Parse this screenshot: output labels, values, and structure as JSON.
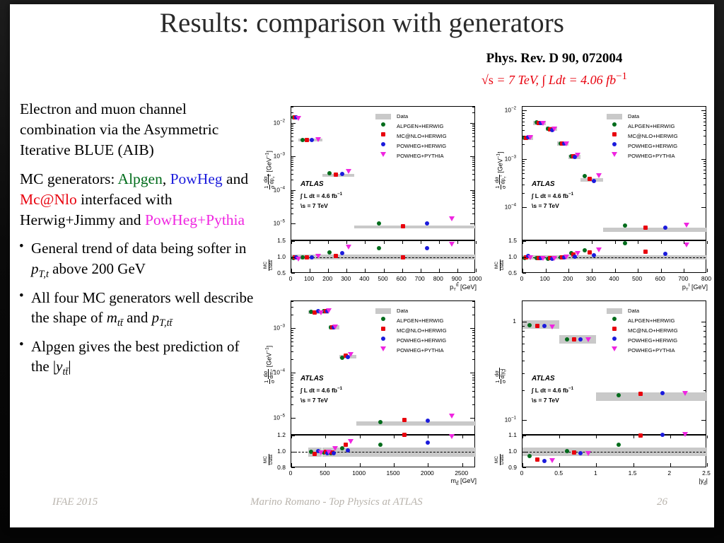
{
  "slide": {
    "title": "Results: comparison with generators",
    "reference": "Phys. Rev. D 90, 072004",
    "lumi_sqrt": "√s",
    "lumi_rest": " = 7 TeV, ∫ Ldt = 4.06 fb",
    "lumi_exp": "−1",
    "footer": {
      "left": "IFAE 2015",
      "center": "Marino Romano - Top Physics at ATLAS",
      "page": "26"
    }
  },
  "text": {
    "p1": "Electron and muon channel combination via the Asymmetric Iterative BLUE (AIB)",
    "p2_pre": "MC generators: ",
    "gen_alpgen": "Alpgen",
    "p2_comma": ", ",
    "gen_powheg": "PowHeg",
    "p2_and": " and ",
    "gen_mcnlo": "Mc@Nlo",
    "p2_mid": " interfaced with Herwig+Jimmy and ",
    "gen_powpythia": "PowHeg+Pythia",
    "bullet1_pre": "General trend of data being softer in ",
    "bullet1_sym": "p",
    "bullet1_sub": "T,t",
    "bullet1_post": " above 200 GeV",
    "bullet2_pre": "All four MC generators well describe the shape of ",
    "bullet2_sym1": "m",
    "bullet2_sub1": "tt̄",
    "bullet2_and": " and ",
    "bullet2_sym2": "p",
    "bullet2_sub2": "T,tt̄",
    "bullet3_pre": "Alpgen gives the best prediction of the ",
    "bullet3_sym": "y",
    "bullet3_sub": "tt̄"
  },
  "legend": {
    "data": "Data",
    "entries": [
      {
        "label": "ALPGEN+HERWIG",
        "color": "#006c1b",
        "marker": "circle"
      },
      {
        "label": "MC@NLO+HERWIG",
        "color": "#e8000d",
        "marker": "square"
      },
      {
        "label": "POWHEG+HERWIG",
        "color": "#1b1bdc",
        "marker": "circle"
      },
      {
        "label": "POWHEG+PYTHIA",
        "color": "#ef25e0",
        "marker": "triangle-down"
      }
    ]
  },
  "atlas_block": {
    "line1": "ATLAS",
    "line2": "∫ L dt = 4.6 fb",
    "line2_exp": "-1",
    "line3": "\\s = 7 TeV"
  },
  "colors": {
    "alpgen": "#006c1b",
    "mcnlo": "#e8000d",
    "powheg_herwig": "#1b1bdc",
    "powheg_pythia": "#ef25e0",
    "data_band": "#c9c9c9",
    "accent_red": "#e8000d"
  },
  "chart_data": [
    {
      "id": "pt_ttbar",
      "position": "top-left",
      "type": "scatter",
      "title": "",
      "xlabel": "p_T^{t#bar{t}} [GeV]",
      "ylabel": "1/σ dσ/dp_T^{t#bar{t}} [GeV^{-1}]",
      "xlim": [
        0,
        1000
      ],
      "xticks": [
        0,
        100,
        200,
        300,
        400,
        500,
        600,
        700,
        800,
        900,
        1000
      ],
      "yscale": "log",
      "ylim": [
        3e-06,
        0.03
      ],
      "ytick_labels": [
        "10^{-2}",
        "10^{-3}",
        "10^{-4}",
        "10^{-5}"
      ],
      "bins": [
        [
          0,
          40
        ],
        [
          40,
          170
        ],
        [
          170,
          340
        ],
        [
          340,
          1000
        ]
      ],
      "data_values": [
        0.0145,
        0.00305,
        0.00027,
        8e-06
      ],
      "series": [
        {
          "name": "ALPGEN+HERWIG",
          "x": [
            12,
            62,
            205,
            475
          ],
          "y": [
            0.0145,
            0.00305,
            0.00031,
            1e-05
          ]
        },
        {
          "name": "MC@NLO+HERWIG",
          "x": [
            20,
            85,
            240,
            605
          ],
          "y": [
            0.0145,
            0.00305,
            0.00028,
            8.2e-06
          ]
        },
        {
          "name": "POWHEG+HERWIG",
          "x": [
            28,
            110,
            275,
            737
          ],
          "y": [
            0.0145,
            0.00305,
            0.0003,
            1e-05
          ]
        },
        {
          "name": "POWHEG+PYTHIA",
          "x": [
            38,
            145,
            310,
            868
          ],
          "y": [
            0.014,
            0.0032,
            0.00036,
            1.4e-05
          ]
        }
      ],
      "ratio": {
        "ylabel": "MC/Data",
        "ylim": [
          0.5,
          1.5
        ],
        "yticks": [
          0.5,
          1.0,
          1.5
        ],
        "refline": 1.0,
        "band": [
          0.93,
          1.08
        ],
        "series": [
          {
            "name": "ALPGEN+HERWIG",
            "x": [
              12,
              62,
              205,
              475
            ],
            "y": [
              0.98,
              1.0,
              1.15,
              1.28
            ]
          },
          {
            "name": "MC@NLO+HERWIG",
            "x": [
              20,
              85,
              240,
              605
            ],
            "y": [
              0.99,
              1.01,
              1.05,
              1.0
            ]
          },
          {
            "name": "POWHEG+HERWIG",
            "x": [
              28,
              110,
              275,
              737
            ],
            "y": [
              0.99,
              1.0,
              1.13,
              1.28
            ]
          },
          {
            "name": "POWHEG+PYTHIA",
            "x": [
              38,
              145,
              310,
              868
            ],
            "y": [
              0.96,
              1.04,
              1.32,
              1.42
            ]
          }
        ]
      }
    },
    {
      "id": "pt_top",
      "position": "top-right",
      "type": "scatter",
      "xlabel": "p_T^{t} [GeV]",
      "ylabel": "1/σ dσ/dp_T^{t} [GeV^{-1}]",
      "xlim": [
        0,
        800
      ],
      "xticks": [
        0,
        100,
        200,
        300,
        400,
        500,
        600,
        700,
        800
      ],
      "yscale": "log",
      "ylim": [
        2e-05,
        0.012
      ],
      "ytick_labels": [
        "10^{-3}",
        "10^{-4}"
      ],
      "bins": [
        [
          0,
          45
        ],
        [
          45,
          100
        ],
        [
          100,
          150
        ],
        [
          150,
          200
        ],
        [
          200,
          250
        ],
        [
          250,
          350
        ],
        [
          350,
          800
        ]
      ],
      "data_values": [
        0.0027,
        0.0055,
        0.0042,
        0.0021,
        0.0011,
        0.00037,
        3.5e-05
      ],
      "series": [
        {
          "name": "ALPGEN+HERWIG",
          "x": [
            8,
            60,
            110,
            165,
            210,
            270,
            443
          ],
          "y": [
            0.0027,
            0.0057,
            0.0042,
            0.0021,
            0.00115,
            0.00044,
            4.2e-05
          ]
        },
        {
          "name": "MC@NLO+HERWIG",
          "x": [
            16,
            70,
            120,
            172,
            220,
            292,
            533
          ],
          "y": [
            0.0027,
            0.0056,
            0.0041,
            0.0021,
            0.00115,
            0.00039,
            3.8e-05
          ]
        },
        {
          "name": "POWHEG+HERWIG",
          "x": [
            24,
            80,
            128,
            180,
            228,
            310,
            620
          ],
          "y": [
            0.0028,
            0.0055,
            0.004,
            0.0021,
            0.0011,
            0.00035,
            3.8e-05
          ]
        },
        {
          "name": "POWHEG+PYTHIA",
          "x": [
            33,
            90,
            138,
            190,
            240,
            332,
            712
          ],
          "y": [
            0.0028,
            0.0056,
            0.0042,
            0.0021,
            0.00122,
            0.00046,
            4.4e-05
          ]
        }
      ],
      "ratio": {
        "ylabel": "MC/Data",
        "ylim": [
          0.5,
          1.5
        ],
        "yticks": [
          0.5,
          1.0,
          1.5
        ],
        "refline": 1.0,
        "band": [
          0.93,
          1.07
        ],
        "series": [
          {
            "name": "ALPGEN+HERWIG",
            "x": [
              8,
              60,
              110,
              165,
              210,
              270,
              443
            ],
            "y": [
              0.98,
              0.97,
              0.96,
              1.0,
              1.12,
              1.22,
              1.44
            ]
          },
          {
            "name": "MC@NLO+HERWIG",
            "x": [
              16,
              70,
              120,
              172,
              220,
              292,
              533
            ],
            "y": [
              1.0,
              0.98,
              0.97,
              1.0,
              1.08,
              1.15,
              1.17
            ]
          },
          {
            "name": "POWHEG+HERWIG",
            "x": [
              24,
              80,
              128,
              180,
              228,
              310,
              620
            ],
            "y": [
              1.05,
              0.98,
              0.95,
              0.99,
              1.03,
              1.06,
              1.1
            ]
          },
          {
            "name": "POWHEG+PYTHIA",
            "x": [
              33,
              90,
              138,
              190,
              240,
              332,
              712
            ],
            "y": [
              1.0,
              0.97,
              0.97,
              1.03,
              1.13,
              1.25,
              1.4
            ]
          }
        ]
      }
    },
    {
      "id": "m_ttbar",
      "position": "bottom-left",
      "type": "scatter",
      "xlabel": "m_{t#bar{t}} [GeV]",
      "ylabel": "1/σ dσ/dm_{t#bar{t}} [GeV^{-1}]",
      "xlim": [
        0,
        2700
      ],
      "xticks": [
        0,
        500,
        1000,
        1500,
        2000,
        2500
      ],
      "yscale": "log",
      "ylim": [
        4e-06,
        0.004
      ],
      "ytick_labels": [
        "10^{-3}",
        "10^{-4}",
        "10^{-5}"
      ],
      "bins": [
        [
          250,
          450
        ],
        [
          450,
          550
        ],
        [
          550,
          700
        ],
        [
          700,
          950
        ],
        [
          950,
          2700
        ]
      ],
      "data_values": [
        0.0023,
        0.0023,
        0.00105,
        0.00023,
        7.5e-06
      ],
      "series": [
        {
          "name": "ALPGEN+HERWIG",
          "x": [
            290,
            480,
            580,
            745,
            1300
          ],
          "y": [
            0.0023,
            0.0024,
            0.00105,
            0.00022,
            8e-06
          ]
        },
        {
          "name": "MC@NLO+HERWIG",
          "x": [
            340,
            505,
            600,
            800,
            1650
          ],
          "y": [
            0.0022,
            0.0024,
            0.00105,
            0.00024,
            9e-06
          ]
        },
        {
          "name": "POWHEG+HERWIG",
          "x": [
            390,
            525,
            620,
            830,
            2000
          ],
          "y": [
            0.0024,
            0.0024,
            0.00103,
            0.00023,
            8.5e-06
          ]
        },
        {
          "name": "POWHEG+PYTHIA",
          "x": [
            430,
            545,
            645,
            865,
            2345
          ],
          "y": [
            0.0022,
            0.0025,
            0.0011,
            0.00026,
            1.1e-05
          ]
        }
      ],
      "ratio": {
        "ylabel": "MC/Data",
        "ylim": [
          0.8,
          1.2
        ],
        "yticks": [
          0.8,
          1.0,
          1.2
        ],
        "refline": 1.0,
        "band": [
          0.94,
          1.05
        ],
        "series": [
          {
            "name": "ALPGEN+HERWIG",
            "x": [
              290,
              480,
              580,
              745,
              1300
            ],
            "y": [
              1.0,
              0.99,
              0.98,
              1.04,
              1.09
            ]
          },
          {
            "name": "MC@NLO+HERWIG",
            "x": [
              340,
              505,
              600,
              800,
              1650
            ],
            "y": [
              0.97,
              1.0,
              0.99,
              1.09,
              1.21
            ]
          },
          {
            "name": "POWHEG+HERWIG",
            "x": [
              390,
              525,
              620,
              830,
              2000
            ],
            "y": [
              1.01,
              0.98,
              0.98,
              1.02,
              1.11
            ]
          },
          {
            "name": "POWHEG+PYTHIA",
            "x": [
              430,
              545,
              645,
              865,
              2345
            ],
            "y": [
              0.99,
              1.0,
              1.04,
              1.13,
              1.19
            ]
          }
        ]
      }
    },
    {
      "id": "y_ttbar",
      "position": "bottom-right",
      "type": "scatter",
      "xlabel": "|y_{t#bar{t}}|",
      "ylabel": "1/σ dσ/d|y_{t#bar{t}}|",
      "xlim": [
        0,
        2.5
      ],
      "xticks": [
        0,
        0.5,
        1.0,
        1.5,
        2.0,
        2.5
      ],
      "yscale": "log",
      "ylim": [
        0.07,
        1.6
      ],
      "ytick_labels": [
        "1",
        "10^{-1}"
      ],
      "bins": [
        [
          0,
          0.5
        ],
        [
          0.5,
          1.0
        ],
        [
          1.0,
          2.5
        ]
      ],
      "data_values": [
        0.93,
        0.66,
        0.175
      ],
      "series": [
        {
          "name": "ALPGEN+HERWIG",
          "x": [
            0.1,
            0.6,
            1.3
          ],
          "y": [
            0.92,
            0.66,
            0.178
          ]
        },
        {
          "name": "MC@NLO+HERWIG",
          "x": [
            0.2,
            0.7,
            1.6
          ],
          "y": [
            0.9,
            0.655,
            0.186
          ]
        },
        {
          "name": "POWHEG+HERWIG",
          "x": [
            0.3,
            0.79,
            1.9
          ],
          "y": [
            0.9,
            0.655,
            0.187
          ]
        },
        {
          "name": "POWHEG+PYTHIA",
          "x": [
            0.4,
            0.89,
            2.2
          ],
          "y": [
            0.89,
            0.655,
            0.187
          ]
        }
      ],
      "ratio": {
        "ylabel": "MC/Data",
        "ylim": [
          0.9,
          1.1
        ],
        "yticks": [
          0.9,
          1.0,
          1.1
        ],
        "refline": 1.0,
        "band": [
          0.975,
          1.025
        ],
        "series": [
          {
            "name": "ALPGEN+HERWIG",
            "x": [
              0.1,
              0.6,
              1.3
            ],
            "y": [
              0.975,
              1.005,
              1.042
            ]
          },
          {
            "name": "MC@NLO+HERWIG",
            "x": [
              0.2,
              0.7,
              1.6
            ],
            "y": [
              0.951,
              0.995,
              1.1
            ]
          },
          {
            "name": "POWHEG+HERWIG",
            "x": [
              0.3,
              0.79,
              1.9
            ],
            "y": [
              0.945,
              0.99,
              1.105
            ]
          },
          {
            "name": "POWHEG+PYTHIA",
            "x": [
              0.4,
              0.89,
              2.2
            ],
            "y": [
              0.948,
              0.99,
              1.11
            ]
          }
        ]
      }
    }
  ]
}
